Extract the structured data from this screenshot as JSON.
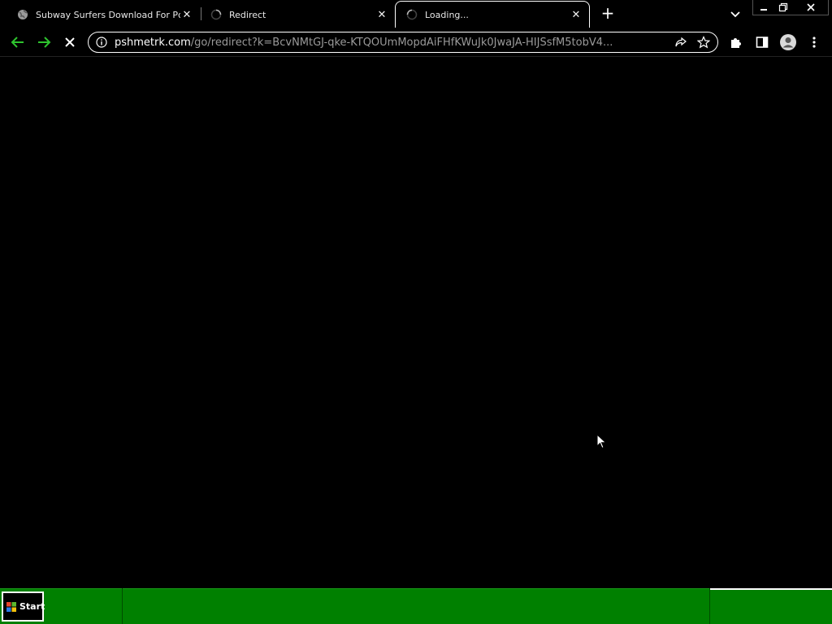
{
  "browser": {
    "tabs": [
      {
        "title": "Subway Surfers Download For Pc",
        "favicon": "globe-icon",
        "close": "✕"
      },
      {
        "title": "Redirect",
        "favicon": "loading-spinner-icon",
        "close": "✕"
      },
      {
        "title": "Loading...",
        "favicon": "loading-spinner-icon",
        "close": "✕",
        "active": true
      }
    ],
    "new_tab_label": "+",
    "address": {
      "host": "pshmetrk.com",
      "path": "/go/redirect?k=BcvNMtGJ-qke-KTQOUmMopdAiFHfKWuJk0JwaJA-HIJSsfM5tobV4..."
    }
  },
  "taskbar": {
    "start_label": "Start",
    "color": "#008000"
  },
  "colors": {
    "nav_arrow": "#2ec42e",
    "background": "#000000"
  }
}
